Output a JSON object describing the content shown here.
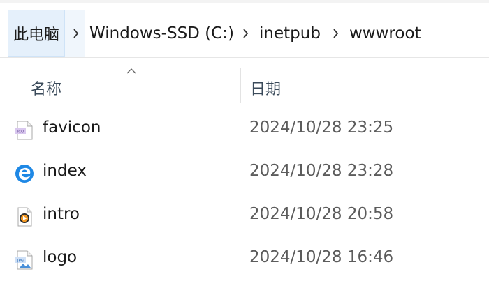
{
  "breadcrumb": {
    "root": "此电脑",
    "segments": [
      "Windows-SSD (C:)",
      "inetpub",
      "wwwroot"
    ]
  },
  "columns": {
    "name": "名称",
    "date": "日期",
    "sorted_by": "name",
    "sort_direction": "ascending"
  },
  "files": [
    {
      "name": "favicon",
      "date": "2024/10/28 23:25",
      "icon": "ico-file-icon"
    },
    {
      "name": "index",
      "date": "2024/10/28 23:28",
      "icon": "edge-html-icon"
    },
    {
      "name": "intro",
      "date": "2024/10/28 20:58",
      "icon": "video-file-icon"
    },
    {
      "name": "logo",
      "date": "2024/10/28 16:46",
      "icon": "jpg-file-icon"
    }
  ],
  "icon_labels": {
    "favicon": "ICO",
    "logo": "JPG"
  },
  "colors": {
    "selected_crumb_bg": "#e5f0fb",
    "date_text": "#5c5c5c",
    "header_text": "#3a4a5a",
    "edge_blue": "#1e88e5"
  }
}
